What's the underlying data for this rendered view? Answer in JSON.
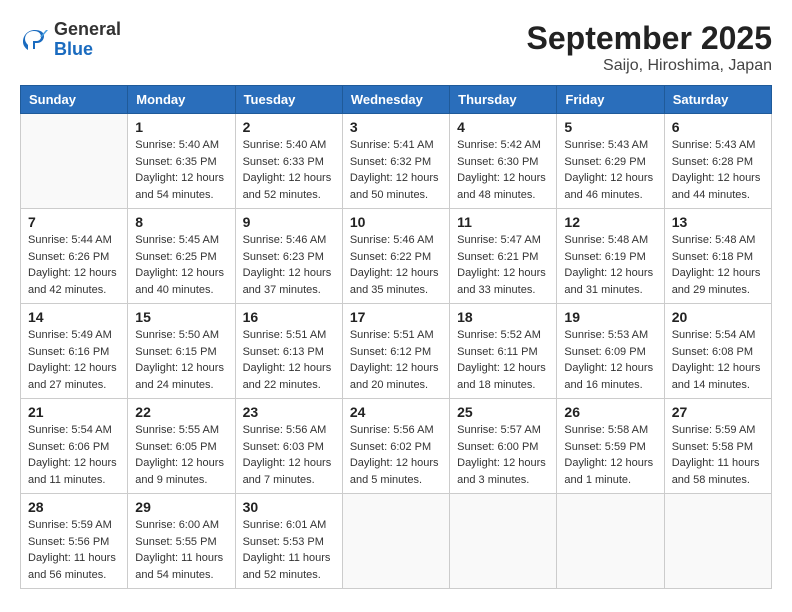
{
  "header": {
    "logo": {
      "general": "General",
      "blue": "Blue"
    },
    "title": "September 2025",
    "subtitle": "Saijo, Hiroshima, Japan"
  },
  "weekdays": [
    "Sunday",
    "Monday",
    "Tuesday",
    "Wednesday",
    "Thursday",
    "Friday",
    "Saturday"
  ],
  "weeks": [
    [
      {
        "day": "",
        "empty": true
      },
      {
        "day": "1",
        "sunrise": "Sunrise: 5:40 AM",
        "sunset": "Sunset: 6:35 PM",
        "daylight": "Daylight: 12 hours and 54 minutes."
      },
      {
        "day": "2",
        "sunrise": "Sunrise: 5:40 AM",
        "sunset": "Sunset: 6:33 PM",
        "daylight": "Daylight: 12 hours and 52 minutes."
      },
      {
        "day": "3",
        "sunrise": "Sunrise: 5:41 AM",
        "sunset": "Sunset: 6:32 PM",
        "daylight": "Daylight: 12 hours and 50 minutes."
      },
      {
        "day": "4",
        "sunrise": "Sunrise: 5:42 AM",
        "sunset": "Sunset: 6:30 PM",
        "daylight": "Daylight: 12 hours and 48 minutes."
      },
      {
        "day": "5",
        "sunrise": "Sunrise: 5:43 AM",
        "sunset": "Sunset: 6:29 PM",
        "daylight": "Daylight: 12 hours and 46 minutes."
      },
      {
        "day": "6",
        "sunrise": "Sunrise: 5:43 AM",
        "sunset": "Sunset: 6:28 PM",
        "daylight": "Daylight: 12 hours and 44 minutes."
      }
    ],
    [
      {
        "day": "7",
        "sunrise": "Sunrise: 5:44 AM",
        "sunset": "Sunset: 6:26 PM",
        "daylight": "Daylight: 12 hours and 42 minutes."
      },
      {
        "day": "8",
        "sunrise": "Sunrise: 5:45 AM",
        "sunset": "Sunset: 6:25 PM",
        "daylight": "Daylight: 12 hours and 40 minutes."
      },
      {
        "day": "9",
        "sunrise": "Sunrise: 5:46 AM",
        "sunset": "Sunset: 6:23 PM",
        "daylight": "Daylight: 12 hours and 37 minutes."
      },
      {
        "day": "10",
        "sunrise": "Sunrise: 5:46 AM",
        "sunset": "Sunset: 6:22 PM",
        "daylight": "Daylight: 12 hours and 35 minutes."
      },
      {
        "day": "11",
        "sunrise": "Sunrise: 5:47 AM",
        "sunset": "Sunset: 6:21 PM",
        "daylight": "Daylight: 12 hours and 33 minutes."
      },
      {
        "day": "12",
        "sunrise": "Sunrise: 5:48 AM",
        "sunset": "Sunset: 6:19 PM",
        "daylight": "Daylight: 12 hours and 31 minutes."
      },
      {
        "day": "13",
        "sunrise": "Sunrise: 5:48 AM",
        "sunset": "Sunset: 6:18 PM",
        "daylight": "Daylight: 12 hours and 29 minutes."
      }
    ],
    [
      {
        "day": "14",
        "sunrise": "Sunrise: 5:49 AM",
        "sunset": "Sunset: 6:16 PM",
        "daylight": "Daylight: 12 hours and 27 minutes."
      },
      {
        "day": "15",
        "sunrise": "Sunrise: 5:50 AM",
        "sunset": "Sunset: 6:15 PM",
        "daylight": "Daylight: 12 hours and 24 minutes."
      },
      {
        "day": "16",
        "sunrise": "Sunrise: 5:51 AM",
        "sunset": "Sunset: 6:13 PM",
        "daylight": "Daylight: 12 hours and 22 minutes."
      },
      {
        "day": "17",
        "sunrise": "Sunrise: 5:51 AM",
        "sunset": "Sunset: 6:12 PM",
        "daylight": "Daylight: 12 hours and 20 minutes."
      },
      {
        "day": "18",
        "sunrise": "Sunrise: 5:52 AM",
        "sunset": "Sunset: 6:11 PM",
        "daylight": "Daylight: 12 hours and 18 minutes."
      },
      {
        "day": "19",
        "sunrise": "Sunrise: 5:53 AM",
        "sunset": "Sunset: 6:09 PM",
        "daylight": "Daylight: 12 hours and 16 minutes."
      },
      {
        "day": "20",
        "sunrise": "Sunrise: 5:54 AM",
        "sunset": "Sunset: 6:08 PM",
        "daylight": "Daylight: 12 hours and 14 minutes."
      }
    ],
    [
      {
        "day": "21",
        "sunrise": "Sunrise: 5:54 AM",
        "sunset": "Sunset: 6:06 PM",
        "daylight": "Daylight: 12 hours and 11 minutes."
      },
      {
        "day": "22",
        "sunrise": "Sunrise: 5:55 AM",
        "sunset": "Sunset: 6:05 PM",
        "daylight": "Daylight: 12 hours and 9 minutes."
      },
      {
        "day": "23",
        "sunrise": "Sunrise: 5:56 AM",
        "sunset": "Sunset: 6:03 PM",
        "daylight": "Daylight: 12 hours and 7 minutes."
      },
      {
        "day": "24",
        "sunrise": "Sunrise: 5:56 AM",
        "sunset": "Sunset: 6:02 PM",
        "daylight": "Daylight: 12 hours and 5 minutes."
      },
      {
        "day": "25",
        "sunrise": "Sunrise: 5:57 AM",
        "sunset": "Sunset: 6:00 PM",
        "daylight": "Daylight: 12 hours and 3 minutes."
      },
      {
        "day": "26",
        "sunrise": "Sunrise: 5:58 AM",
        "sunset": "Sunset: 5:59 PM",
        "daylight": "Daylight: 12 hours and 1 minute."
      },
      {
        "day": "27",
        "sunrise": "Sunrise: 5:59 AM",
        "sunset": "Sunset: 5:58 PM",
        "daylight": "Daylight: 11 hours and 58 minutes."
      }
    ],
    [
      {
        "day": "28",
        "sunrise": "Sunrise: 5:59 AM",
        "sunset": "Sunset: 5:56 PM",
        "daylight": "Daylight: 11 hours and 56 minutes."
      },
      {
        "day": "29",
        "sunrise": "Sunrise: 6:00 AM",
        "sunset": "Sunset: 5:55 PM",
        "daylight": "Daylight: 11 hours and 54 minutes."
      },
      {
        "day": "30",
        "sunrise": "Sunrise: 6:01 AM",
        "sunset": "Sunset: 5:53 PM",
        "daylight": "Daylight: 11 hours and 52 minutes."
      },
      {
        "day": "",
        "empty": true
      },
      {
        "day": "",
        "empty": true
      },
      {
        "day": "",
        "empty": true
      },
      {
        "day": "",
        "empty": true
      }
    ]
  ]
}
